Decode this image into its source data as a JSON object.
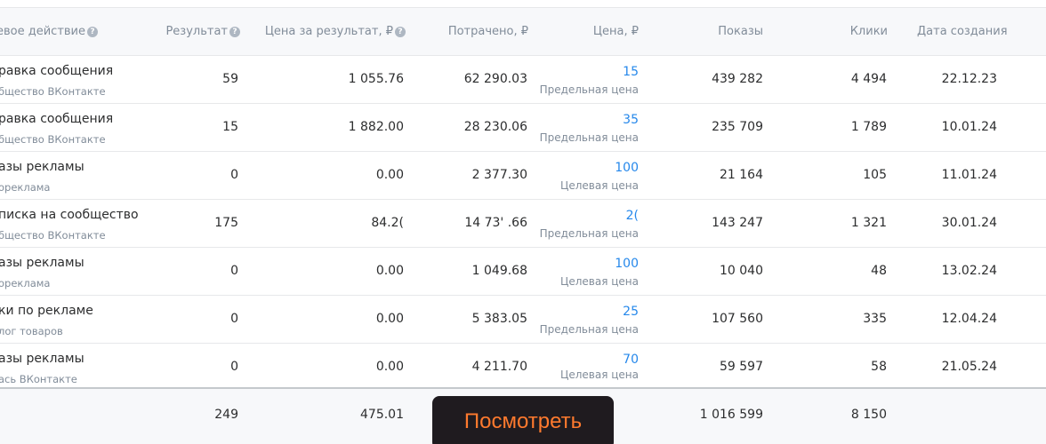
{
  "header": {
    "goal": "евое действие",
    "result": "Результат",
    "cost_per_result": "Цена за результат, ₽",
    "spent": "Потрачено, ₽",
    "price": "Цена, ₽",
    "impressions": "Показы",
    "clicks": "Клики",
    "created": "Дата создания",
    "help_glyph": "?"
  },
  "rows": [
    {
      "goal": "равка сообщения",
      "source": "бщество ВКонтакте",
      "result": "59",
      "cost_per_result": "1 055.76",
      "spent": "62 290.03",
      "price": "15",
      "price_type": "Предельная цена",
      "impressions": "439 282",
      "clicks": "4 494",
      "created": "22.12.23"
    },
    {
      "goal": "равка сообщения",
      "source": "бщество ВКонтакте",
      "result": "15",
      "cost_per_result": "1 882.00",
      "spent": "28 230.06",
      "price": "35",
      "price_type": "Предельная цена",
      "impressions": "235 709",
      "clicks": "1 789",
      "created": "10.01.24"
    },
    {
      "goal": "азы рекламы",
      "source": "ореклама",
      "result": "0",
      "cost_per_result": "0.00",
      "spent": "2 377.30",
      "price": "100",
      "price_type": "Целевая цена",
      "impressions": "21 164",
      "clicks": "105",
      "created": "11.01.24"
    },
    {
      "goal": "писка на сообщество",
      "source": "бщество ВКонтакте",
      "result": "175",
      "cost_per_result": "84.2(",
      "spent": "14 73' .66",
      "price": "2(",
      "price_type": "Предельная цена",
      "impressions": "143 247",
      "clicks": "1 321",
      "created": "30.01.24"
    },
    {
      "goal": "азы рекламы",
      "source": "ореклама",
      "result": "0",
      "cost_per_result": "0.00",
      "spent": "1 049.68",
      "price": "100",
      "price_type": "Целевая цена",
      "impressions": "10 040",
      "clicks": "48",
      "created": "13.02.24"
    },
    {
      "goal": "ки по рекламе",
      "source": "лог товаров",
      "result": "0",
      "cost_per_result": "0.00",
      "spent": "5 383.05",
      "price": "25",
      "price_type": "Предельная цена",
      "impressions": "107 560",
      "clicks": "335",
      "created": "12.04.24"
    },
    {
      "goal": "азы рекламы",
      "source": "ась ВКонтакте",
      "result": "0",
      "cost_per_result": "0.00",
      "spent": "4 211.70",
      "price": "70",
      "price_type": "Целевая цена",
      "impressions": "59 597",
      "clicks": "58",
      "created": "21.05.24"
    }
  ],
  "totals": {
    "result": "249",
    "cost_per_result": "475.01",
    "impressions": "1 016 599",
    "clicks": "8 150"
  },
  "view_button": {
    "label": "Посмотреть"
  },
  "colors": {
    "accent": "#2688eb",
    "button_bg": "#1f1b1f",
    "button_text": "#ff7a2e",
    "muted": "#818c99"
  }
}
